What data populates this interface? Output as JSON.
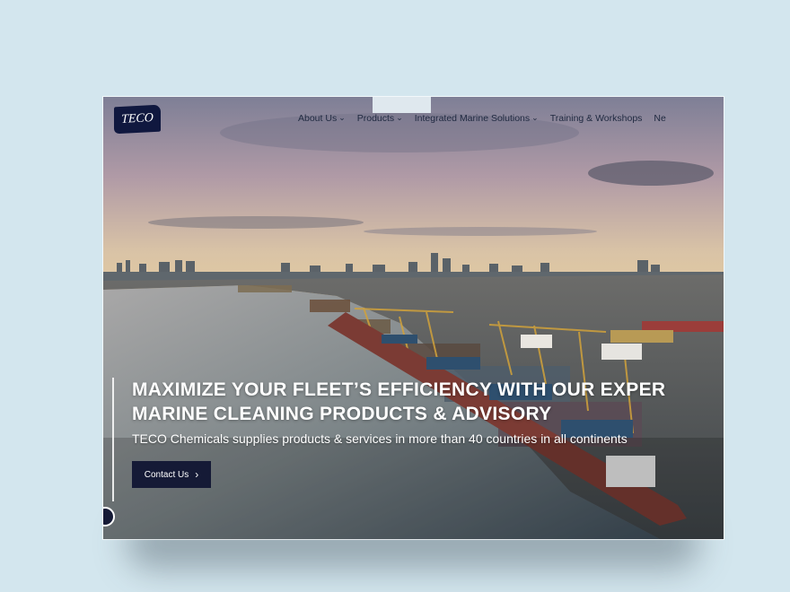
{
  "logo": {
    "text": "TECO"
  },
  "nav": {
    "items": [
      {
        "label": "About Us",
        "has_dropdown": true
      },
      {
        "label": "Products",
        "has_dropdown": true
      },
      {
        "label": "Integrated Marine Solutions",
        "has_dropdown": true
      },
      {
        "label": "Training & Workshops",
        "has_dropdown": false
      },
      {
        "label": "Ne",
        "has_dropdown": false
      }
    ],
    "chevron_icon": "chevron-down-icon"
  },
  "hero": {
    "headline_line1": "MAXIMIZE YOUR FLEET’S EFFICIENCY WITH OUR EXPER",
    "headline_line2": "MARINE CLEANING PRODUCTS & ADVISORY",
    "subheadline": "TECO Chemicals supplies products & services in more than 40 countries in all continents",
    "cta_label": "Contact Us",
    "cta_icon": "chevron-right-icon"
  },
  "colors": {
    "brand_navy": "#10183f",
    "button_navy": "#151a36",
    "page_background": "#d3e6ee"
  }
}
